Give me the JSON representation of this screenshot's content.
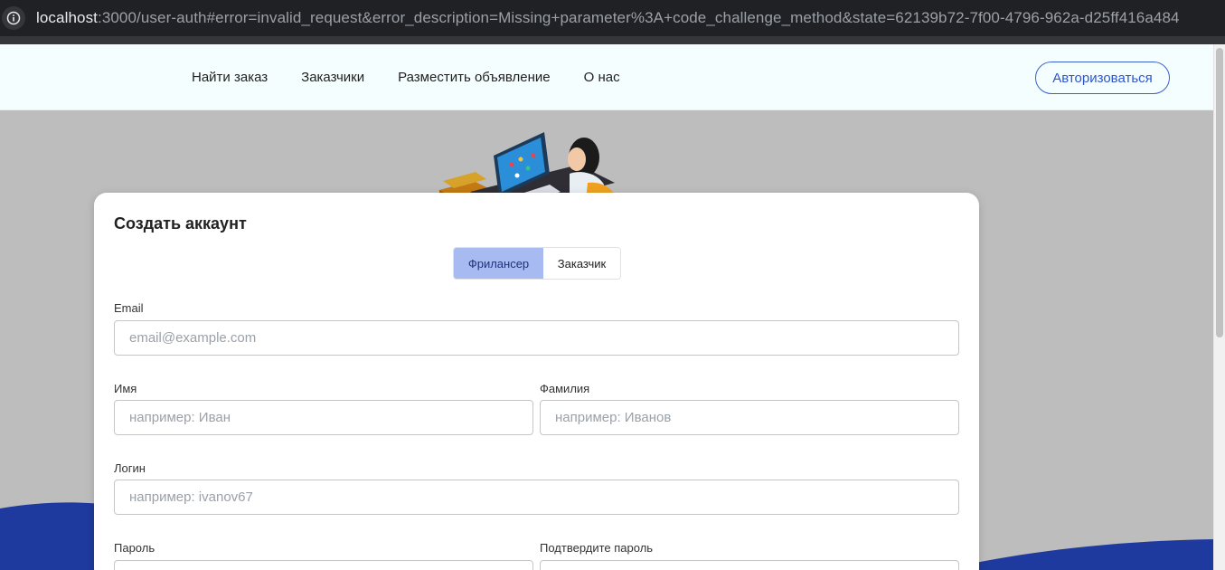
{
  "browser": {
    "url_host": "localhost",
    "url_rest": ":3000/user-auth#error=invalid_request&error_description=Missing+parameter%3A+code_challenge_method&state=62139b72-7f00-4796-962a-d25ff416a484"
  },
  "header": {
    "nav": [
      {
        "label": "Найти заказ"
      },
      {
        "label": "Заказчики"
      },
      {
        "label": "Разместить объявление"
      },
      {
        "label": "О нас"
      }
    ],
    "auth_button": "Авторизоваться"
  },
  "form": {
    "title": "Создать аккаунт",
    "role_toggle": {
      "freelancer": "Фрилансер",
      "customer": "Заказчик",
      "selected": "Фрилансер"
    },
    "email": {
      "label": "Email",
      "placeholder": "email@example.com",
      "value": ""
    },
    "first_name": {
      "label": "Имя",
      "placeholder": "например: Иван",
      "value": ""
    },
    "last_name": {
      "label": "Фамилия",
      "placeholder": "например: Иванов",
      "value": ""
    },
    "login": {
      "label": "Логин",
      "placeholder": "например: ivanov67",
      "value": ""
    },
    "password": {
      "label": "Пароль",
      "value": ""
    },
    "confirm_password": {
      "label": "Подтвердите пароль",
      "value": ""
    }
  },
  "colors": {
    "accent": "#2d55cc",
    "toggle_active": "#a8baf2",
    "wave": "#1f3a9e",
    "page_bg": "#bdbdbd"
  },
  "icons": {
    "address_info": "info-icon",
    "illustration": "person-at-computer-illustration"
  }
}
